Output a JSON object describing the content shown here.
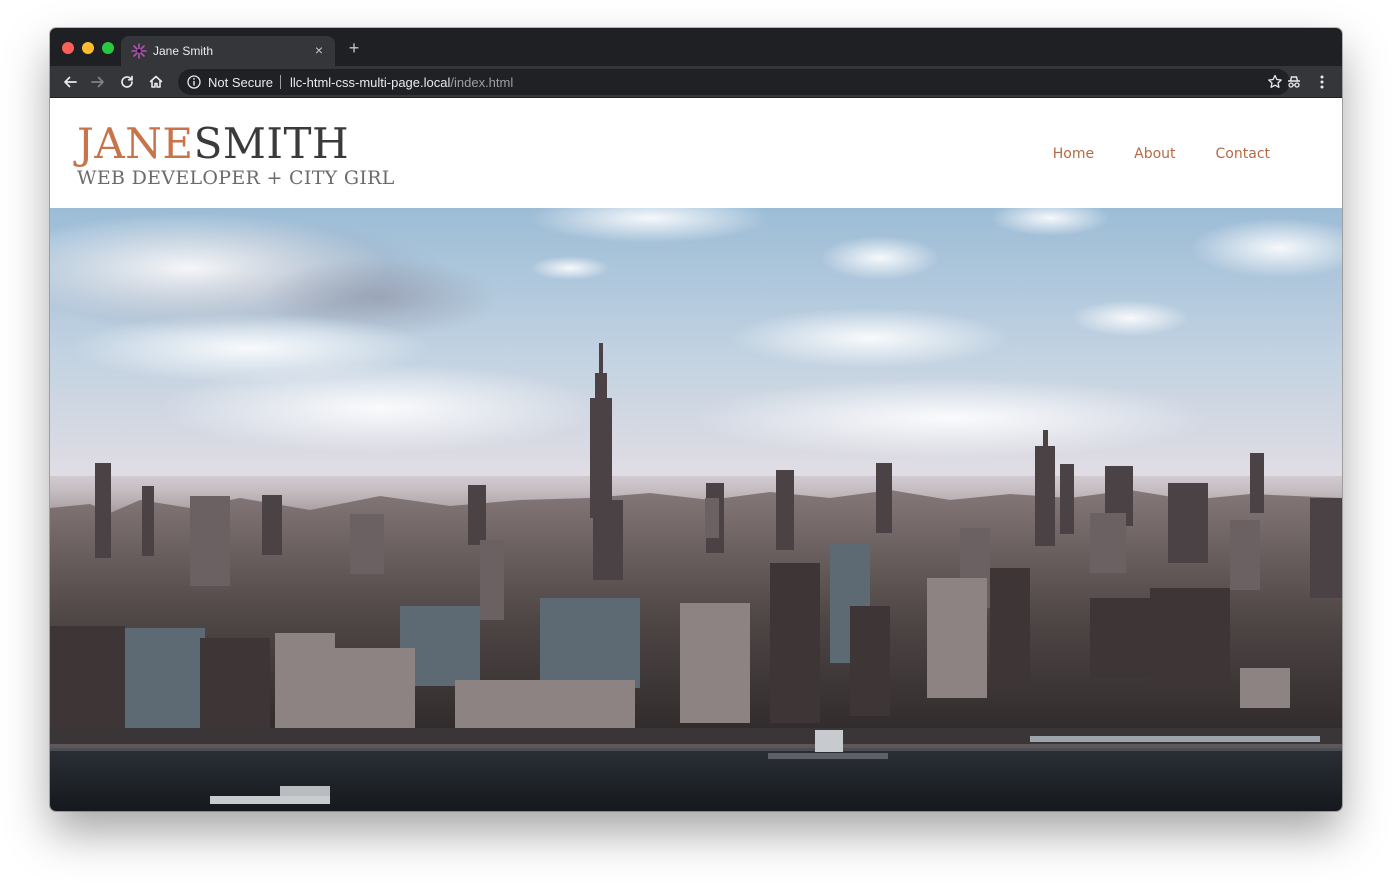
{
  "browser": {
    "tab": {
      "title": "Jane Smith",
      "close_glyph": "×",
      "favicon": "sparkle-icon"
    },
    "new_tab_glyph": "+",
    "toolbar": {
      "back": "back-arrow-icon",
      "forward": "forward-arrow-icon",
      "reload": "reload-icon",
      "home": "home-icon",
      "security_label": "Not Secure",
      "url_host": "llc-html-css-multi-page.local",
      "url_path": "/index.html",
      "bookmark": "star-icon",
      "extension": "incognito-icon",
      "menu": "kebab-menu-icon"
    }
  },
  "site": {
    "logo_first": "JANE",
    "logo_last": "SMITH",
    "tagline": "WEB DEVELOPER + CITY GIRL",
    "nav": [
      {
        "label": "Home"
      },
      {
        "label": "About"
      },
      {
        "label": "Contact"
      }
    ],
    "hero_image": "city-skyline-image"
  },
  "colors": {
    "accent": "#c8744a",
    "nav_link": "#b56a45",
    "chrome_dark": "#1f2023",
    "chrome_toolbar": "#35363a"
  }
}
